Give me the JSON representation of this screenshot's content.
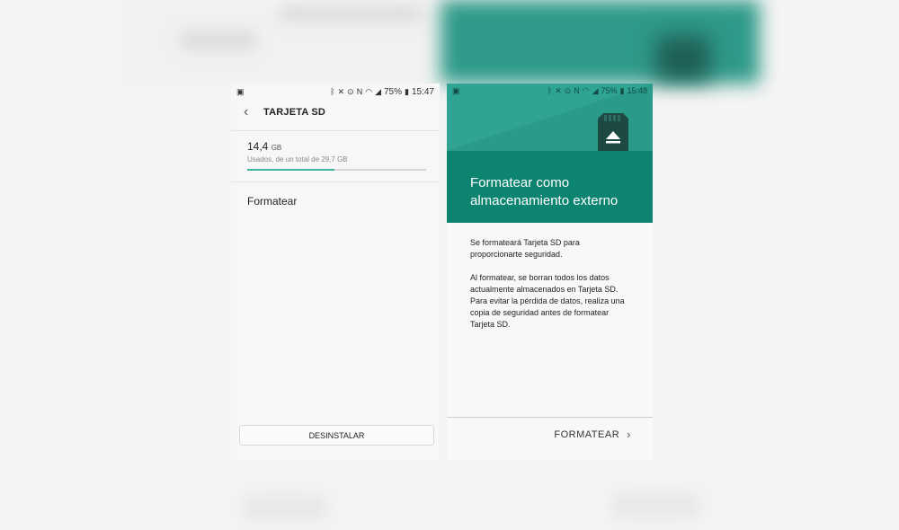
{
  "left": {
    "status": {
      "battery": "75%",
      "time": "15:47"
    },
    "title": "TARJETA SD",
    "storage": {
      "used_value": "14,4",
      "used_unit": "GB",
      "subtitle": "Usados, de un total de 29,7 GB",
      "usage_fraction": 0.485
    },
    "menu": {
      "format_label": "Formatear"
    },
    "uninstall_label": "DESINSTALAR"
  },
  "right": {
    "status": {
      "battery": "75%",
      "time": "15:48"
    },
    "heading": "Formatear como almacenamiento externo",
    "paragraph1": "Se formateará Tarjeta SD para proporcionarte seguridad.",
    "paragraph2": "Al formatear, se borran todos los datos actualmente almacenados en Tarjeta SD. Para evitar la pérdida de datos, realiza una copia de seguridad antes de formatear Tarjeta SD.",
    "format_label": "FORMATEAR"
  },
  "icons": {
    "back": "back-arrow-icon",
    "chevron": "chevron-right-icon",
    "sd": "sd-card-eject-icon"
  },
  "colors": {
    "accent": "#3fb5a0",
    "hero": "#2fa492",
    "hero_dark": "#0c8470",
    "sd_card": "#1c4a43"
  }
}
